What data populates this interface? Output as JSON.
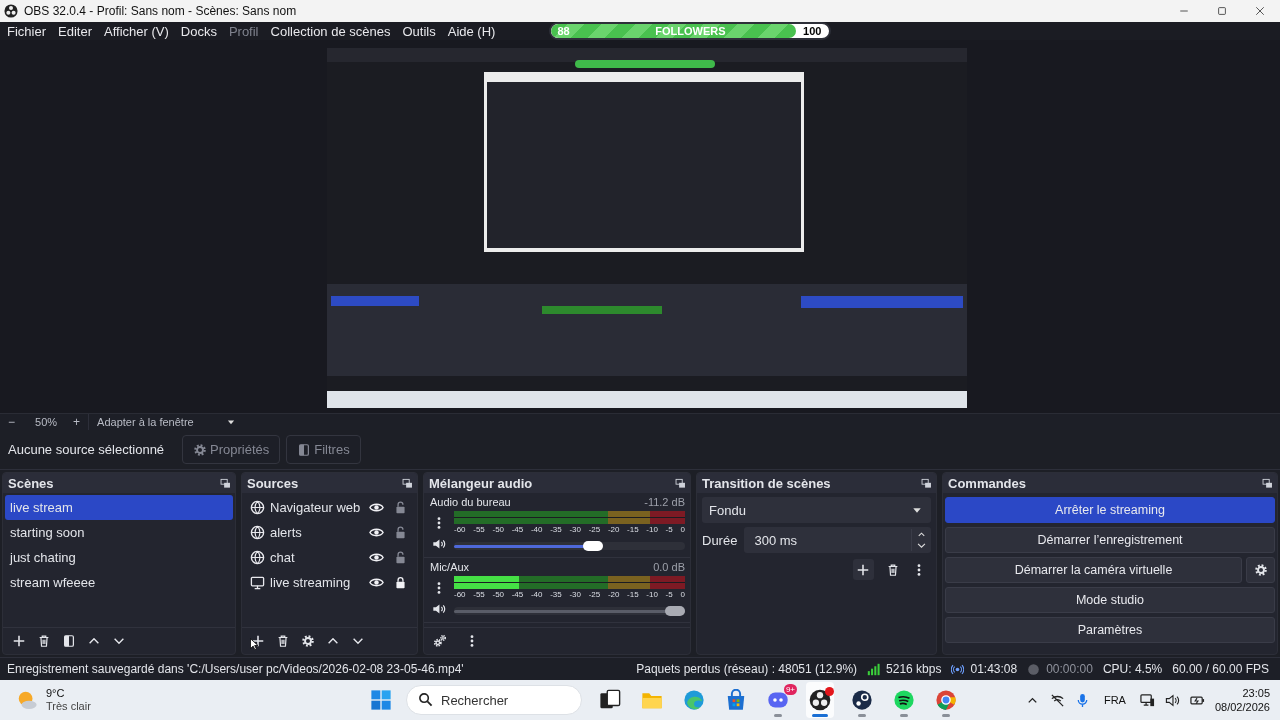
{
  "window": {
    "title": "OBS 32.0.4 - Profil: Sans nom - Scènes: Sans nom"
  },
  "menu": [
    {
      "label": "Fichier",
      "disabled": false
    },
    {
      "label": "Editer",
      "disabled": false
    },
    {
      "label": "Afficher (V)",
      "disabled": false
    },
    {
      "label": "Docks",
      "disabled": false
    },
    {
      "label": "Profil",
      "disabled": true
    },
    {
      "label": "Collection de scènes",
      "disabled": false
    },
    {
      "label": "Outils",
      "disabled": false
    },
    {
      "label": "Aide (H)",
      "disabled": false
    }
  ],
  "followers": {
    "current": "88",
    "label": "FOLLOWERS",
    "goal": "100",
    "level": 0.88
  },
  "zoom_bar": {
    "zoom_out": "−",
    "zoom": "50%",
    "zoom_in": "+",
    "fit": "Adapter à la fenêtre"
  },
  "source_toolbar": {
    "status": "Aucune source sélectionné",
    "buttons": [
      {
        "kind": "properties",
        "label": "Propriétés",
        "disabled": true
      },
      {
        "kind": "filters",
        "label": "Filtres",
        "disabled": true
      }
    ]
  },
  "scenes": {
    "title": "Scènes",
    "items": [
      {
        "name": "live stream",
        "selected": true
      },
      {
        "name": "starting soon",
        "selected": false
      },
      {
        "name": "just chating",
        "selected": false
      },
      {
        "name": "stream wfeeee",
        "selected": false
      }
    ]
  },
  "sources": {
    "title": "Sources",
    "items": [
      {
        "name": "Navigateur web",
        "kind": "browser",
        "visible": true,
        "locked": false
      },
      {
        "name": "alerts",
        "kind": "browser",
        "visible": true,
        "locked": false
      },
      {
        "name": "chat",
        "kind": "browser",
        "visible": true,
        "locked": false
      },
      {
        "name": "live streaming",
        "kind": "display",
        "visible": true,
        "locked": true
      }
    ]
  },
  "audio_mixer": {
    "title": "Mélangeur audio",
    "channels": [
      {
        "name": "Audio du bureau",
        "reading": "-11.2 dB",
        "meter": {
          "level": 0
        },
        "scale": [
          "-60",
          "-55",
          "-50",
          "-45",
          "-40",
          "-35",
          "-30",
          "-25",
          "-20",
          "-15",
          "-10",
          "-5",
          "0"
        ],
        "volume": {
          "level": 0.61
        },
        "highlighted": true
      },
      {
        "name": "Mic/Aux",
        "reading": "0.0 dB",
        "meter": {
          "level": 0.28
        },
        "scale": [
          "-60",
          "-55",
          "-50",
          "-45",
          "-40",
          "-35",
          "-30",
          "-25",
          "-20",
          "-15",
          "-10",
          "-5",
          "0"
        ],
        "volume": {
          "level": 1
        },
        "highlighted": false
      }
    ]
  },
  "transition": {
    "title": "Transition de scènes",
    "type": "Fondu",
    "duration_label": "Durée",
    "duration": "300 ms"
  },
  "controls": {
    "title": "Commandes",
    "buttons": [
      {
        "label": "Arrêter le streaming",
        "active": true,
        "settings": false
      },
      {
        "label": "Démarrer l’enregistrement",
        "active": false,
        "settings": false
      },
      {
        "label": "Démarrer la caméra virtuelle",
        "active": false,
        "settings": true
      },
      {
        "label": "Mode studio",
        "active": false,
        "settings": false
      },
      {
        "label": "Paramètres",
        "active": false,
        "settings": false
      }
    ]
  },
  "status_bar": {
    "message": "Enregistrement sauvegardé dans 'C:/Users/user pc/Videos/2026-02-08 23-05-46.mp4'",
    "dropped_frames": "Paquets perdus (réseau) : 48051 (12.9%)",
    "bitrate": "5216 kbps",
    "stream_time": "01:43:08",
    "record_time": "00:00:00",
    "cpu": "CPU: 4.5%",
    "fps": "60.00 / 60.00 FPS"
  },
  "taskbar": {
    "weather": {
      "temperature": "9°C",
      "condition": "Très clair"
    },
    "search": {
      "placeholder": "Rechercher"
    },
    "apps": [
      {
        "kind": "taskview",
        "running": false,
        "selected": false,
        "dot": false
      },
      {
        "kind": "explorer",
        "running": false,
        "selected": false,
        "dot": false
      },
      {
        "kind": "edge",
        "running": false,
        "selected": false,
        "dot": false
      },
      {
        "kind": "store",
        "running": false,
        "selected": false,
        "dot": false
      },
      {
        "kind": "discord",
        "running": true,
        "selected": false,
        "dot": false,
        "badge": "9+"
      },
      {
        "kind": "obs",
        "running": true,
        "selected": true,
        "dot": true
      },
      {
        "kind": "steam",
        "running": true,
        "selected": false,
        "dot": false
      },
      {
        "kind": "spotify",
        "running": true,
        "selected": false,
        "dot": false
      },
      {
        "kind": "chrome",
        "running": true,
        "selected": false,
        "dot": false
      }
    ],
    "tray": {
      "language": "FRA",
      "time": "23:05",
      "date": "08/02/2026"
    }
  }
}
